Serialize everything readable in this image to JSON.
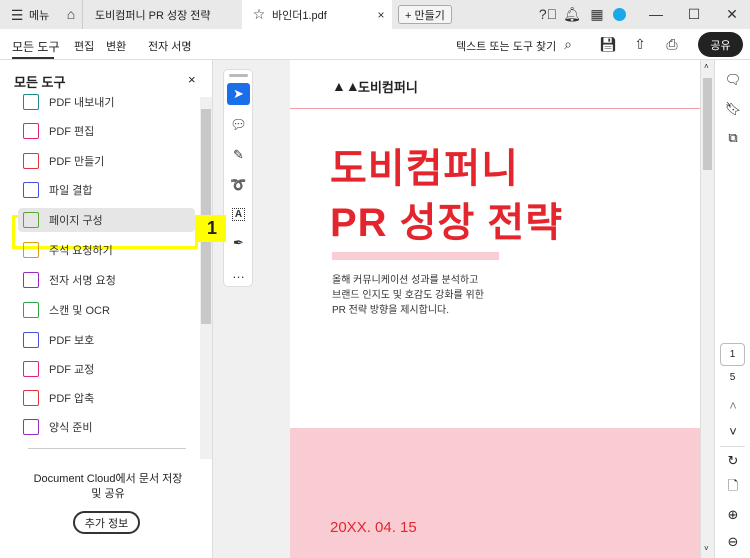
{
  "tabbar": {
    "menu": "메뉴",
    "tabs": [
      {
        "title": "도비컴퍼니 PR 성장 전략"
      },
      {
        "title": "바인더1.pdf"
      }
    ],
    "new_button": "+ 만들기"
  },
  "menubar": {
    "items": [
      "모든 도구",
      "편집",
      "변환",
      "전자 서명"
    ],
    "search": "텍스트 또는 도구 찾기",
    "share": "공유"
  },
  "panel": {
    "title": "모든 도구",
    "items": [
      {
        "label": "PDF 내보내기",
        "icon": "export-pdf-icon",
        "color": "#1a8a8a"
      },
      {
        "label": "PDF 편집",
        "icon": "edit-pdf-icon",
        "color": "#e0247a"
      },
      {
        "label": "PDF 만들기",
        "icon": "create-pdf-icon",
        "color": "#e0343a"
      },
      {
        "label": "파일 결합",
        "icon": "combine-files-icon",
        "color": "#4a4fd8"
      },
      {
        "label": "페이지 구성",
        "icon": "organize-pages-icon",
        "color": "#5aa832"
      },
      {
        "label": "주석 요청하기",
        "icon": "request-comments-icon",
        "color": "#d8a012"
      },
      {
        "label": "전자 서명 요청",
        "icon": "request-esign-icon",
        "color": "#9a2ac8"
      },
      {
        "label": "스캔 및 OCR",
        "icon": "scan-ocr-icon",
        "color": "#2aa848"
      },
      {
        "label": "PDF 보호",
        "icon": "protect-pdf-icon",
        "color": "#4a4fd8"
      },
      {
        "label": "PDF 교정",
        "icon": "redact-pdf-icon",
        "color": "#e0247a"
      },
      {
        "label": "PDF 압축",
        "icon": "compress-pdf-icon",
        "color": "#e0343a"
      },
      {
        "label": "양식 준비",
        "icon": "prepare-form-icon",
        "color": "#9a2ac8"
      }
    ],
    "highlight_badge": "1",
    "cloud_text": "Document Cloud에서 문서 저장 및 공유",
    "more_button": "추가 정보"
  },
  "document": {
    "company": "도비컴퍼니",
    "title1": "도비컴퍼니",
    "title2": "PR 성장 전략",
    "desc": [
      "올해 커뮤니케이션 성과를 분석하고",
      "브랜드 인지도 및 호감도 강화를 위한",
      "PR 전략 방향을 제시합니다."
    ],
    "date": "20XX. 04. 15",
    "accent": "#e3262e",
    "pink": "#f9ccd4"
  },
  "pager": {
    "current": "1",
    "total": "5"
  }
}
